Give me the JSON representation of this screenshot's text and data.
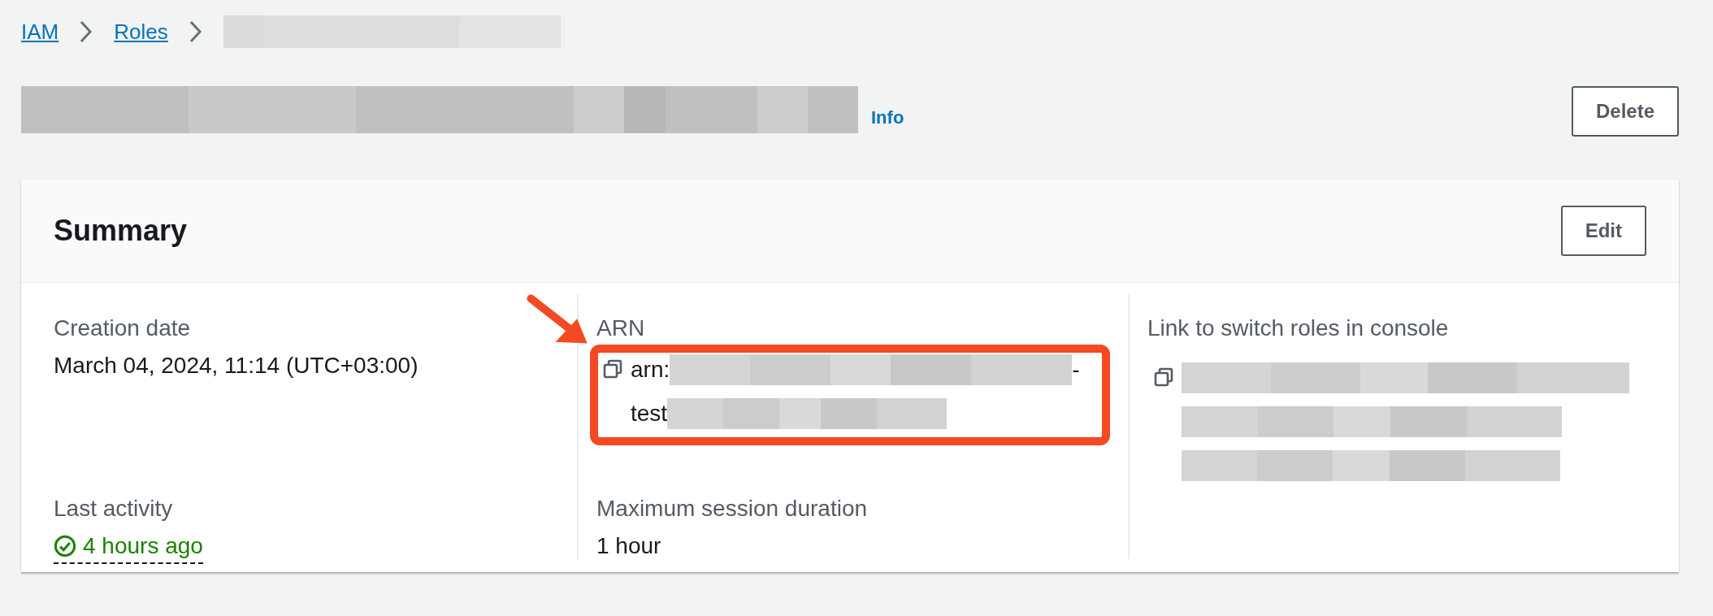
{
  "breadcrumbs": [
    {
      "label": "IAM",
      "kind": "link"
    },
    {
      "label": "Roles",
      "kind": "link"
    },
    {
      "kind": "redacted"
    }
  ],
  "header": {
    "title": {
      "kind": "redacted"
    },
    "info_link": "Info",
    "actions": [
      "Delete"
    ]
  },
  "summary": {
    "title": "Summary",
    "edit_button": "Edit",
    "columns": [
      [
        {
          "kind": "text",
          "label": "Creation date",
          "value": "March 04, 2024, 11:14 (UTC+03:00)"
        },
        {
          "kind": "status",
          "label": "Last activity",
          "success": true,
          "value": "4 hours ago"
        }
      ],
      [
        {
          "kind": "copy",
          "label": "ARN",
          "highlighted": true,
          "lines": [
            [
              {
                "kind": "text",
                "text": "arn:"
              },
              {
                "kind": "redacted"
              },
              {
                "kind": "text",
                "text": "-"
              }
            ],
            [
              {
                "kind": "text",
                "text": "test"
              },
              {
                "kind": "redacted"
              }
            ]
          ]
        },
        {
          "kind": "text",
          "label": "Maximum session duration",
          "value": "1 hour"
        }
      ],
      [
        {
          "kind": "copy",
          "label": "Link to switch roles in console",
          "highlighted": false,
          "lines": [
            [
              {
                "kind": "redacted"
              }
            ],
            [
              {
                "kind": "redacted"
              }
            ],
            [
              {
                "kind": "redacted"
              }
            ]
          ]
        }
      ]
    ]
  }
}
